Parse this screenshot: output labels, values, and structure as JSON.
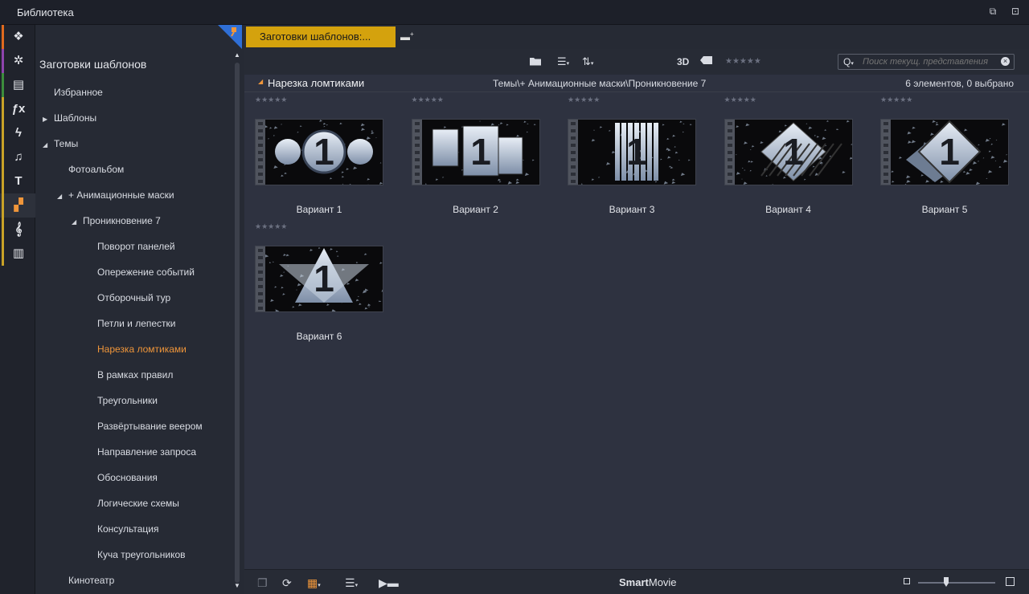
{
  "window": {
    "title": "Библиотека"
  },
  "iconbar": [
    {
      "icon": "project-bin-icon",
      "glyph": "❖",
      "stripe": "#e06a1e"
    },
    {
      "icon": "film-reel-icon",
      "glyph": "✲",
      "stripe": "#8e44ad"
    },
    {
      "icon": "photo-stack-icon",
      "glyph": "▤",
      "stripe": "#3c8d3c"
    },
    {
      "icon": "fx-icon",
      "glyph": "ƒx",
      "stripe": "#c9a227"
    },
    {
      "icon": "lightning-icon",
      "glyph": "ϟ",
      "stripe": "#c9a227"
    },
    {
      "icon": "music-note-icon",
      "glyph": "♫",
      "stripe": "#c9a227"
    },
    {
      "icon": "title-icon",
      "glyph": "T",
      "stripe": "#c9a227"
    },
    {
      "icon": "montage-icon",
      "glyph": "▞",
      "stripe": "#c9a227"
    },
    {
      "icon": "treble-clef-icon",
      "glyph": "𝄞",
      "stripe": "#c9a227"
    },
    {
      "icon": "piano-icon",
      "glyph": "▥",
      "stripe": "#c9a227"
    }
  ],
  "tree": {
    "header": "Заготовки шаблонов",
    "items": [
      {
        "label": "Избранное",
        "tri": ""
      },
      {
        "label": "Шаблоны",
        "tri": "▶"
      },
      {
        "label": "Темы",
        "tri": "◢"
      },
      {
        "label": "Фотоальбом",
        "tri": ""
      },
      {
        "label": "+ Анимационные маски",
        "tri": "◢"
      },
      {
        "label": "Проникновение 7",
        "tri": "◢"
      },
      {
        "label": "Поворот панелей",
        "tri": ""
      },
      {
        "label": "Опережение событий",
        "tri": ""
      },
      {
        "label": "Отборочный тур",
        "tri": ""
      },
      {
        "label": "Петли и лепестки",
        "tri": ""
      },
      {
        "label": "Нарезка ломтиками",
        "tri": ""
      },
      {
        "label": "В рамках правил",
        "tri": ""
      },
      {
        "label": "Треугольники",
        "tri": ""
      },
      {
        "label": "Развёртывание веером",
        "tri": ""
      },
      {
        "label": "Направление запроса",
        "tri": ""
      },
      {
        "label": "Обоснования",
        "tri": ""
      },
      {
        "label": "Логические схемы",
        "tri": ""
      },
      {
        "label": "Консультация",
        "tri": ""
      },
      {
        "label": "Куча треугольников",
        "tri": ""
      },
      {
        "label": "Кинотеатр",
        "tri": ""
      }
    ],
    "selected_index": 10
  },
  "tabs": [
    {
      "label": "Заготовки шаблонов:..."
    }
  ],
  "toolbar": {
    "label_3d": "3D",
    "stars": "★★★★★",
    "search_placeholder": "Поиск текущ. представления"
  },
  "pathbar": {
    "collection": "Нарезка ломтиками",
    "path": "Темы\\+ Анимационные маски\\Проникновение 7",
    "count": "6 элементов, 0 выбрано"
  },
  "items": [
    {
      "label": "Вариант 1",
      "rating": "★★★★★",
      "style": "circles"
    },
    {
      "label": "Вариант 2",
      "rating": "★★★★★",
      "style": "panels"
    },
    {
      "label": "Вариант 3",
      "rating": "★★★★★",
      "style": "slices"
    },
    {
      "label": "Вариант 4",
      "rating": "★★★★★",
      "style": "diamond-strips"
    },
    {
      "label": "Вариант 5",
      "rating": "★★★★★",
      "style": "diamond-stack"
    },
    {
      "label": "Вариант 6",
      "rating": "★★★★★",
      "style": "triangle"
    }
  ],
  "bottombar": {
    "brand_bold": "Smart",
    "brand_rest": "Movie",
    "accent": "#f0963a"
  },
  "colors": {
    "accent": "#f0963a",
    "tab": "#d4a20d"
  }
}
